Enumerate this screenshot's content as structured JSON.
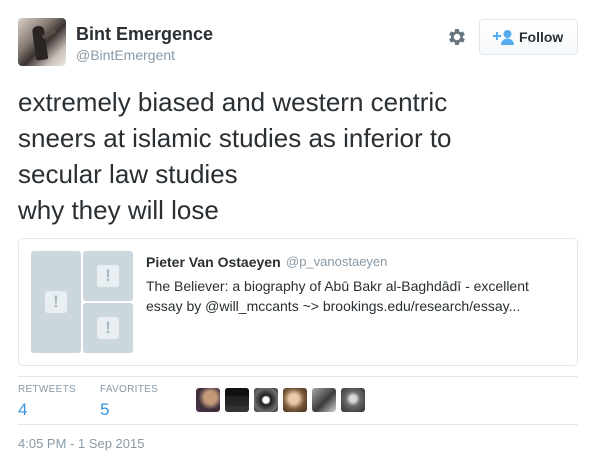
{
  "user": {
    "name": "Bint Emergence",
    "handle": "@BintEmergent"
  },
  "actions": {
    "settings_icon": "gear-icon",
    "follow_label": "Follow",
    "follow_icon": "add-person-icon"
  },
  "tweet": {
    "lines": [
      "extremely biased and western centric",
      "sneers at islamic studies as inferior to",
      "secular law studies",
      "why they will lose"
    ]
  },
  "quoted_tweet": {
    "author_name": "Pieter Van Ostaeyen",
    "author_handle": "@p_vanostaeyen",
    "text_lines": [
      "The Believer: a biography of Abū Bakr al-Baghdādī - excellent",
      "essay by @will_mccants ~> brookings.edu/research/essay..."
    ],
    "image_placeholder_icon": "exclamation-icon"
  },
  "stats": {
    "retweets_label": "RETWEETS",
    "retweets_count": "4",
    "favorites_label": "FAVORITES",
    "favorites_count": "5"
  },
  "favoriters": {
    "count_shown": 6
  },
  "timestamp": "4:05 PM - 1 Sep 2015",
  "colors": {
    "link_blue": "#3b94d9",
    "muted_gray": "#8899a6",
    "text_dark": "#292f33",
    "border": "#e1e8ed"
  }
}
